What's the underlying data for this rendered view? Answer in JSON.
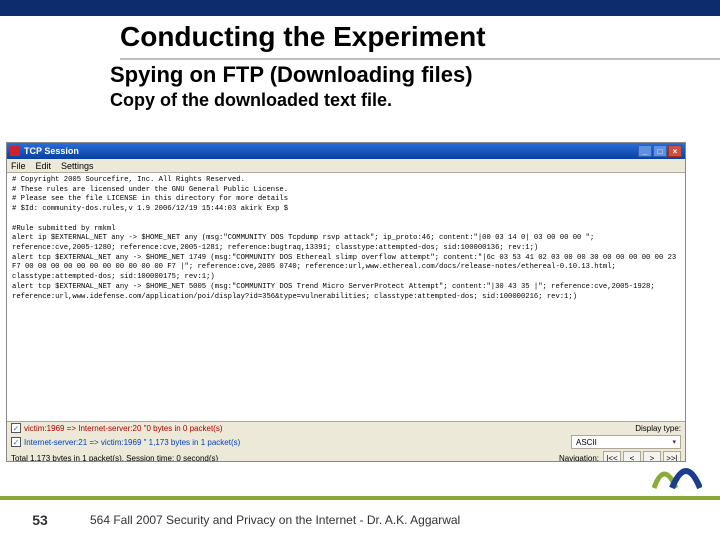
{
  "slide": {
    "title": "Conducting the Experiment",
    "subtitle1": "Spying on FTP (Downloading files)",
    "subtitle2": "Copy of the downloaded text file.",
    "number": "53",
    "footer": "564  Fall 2007 Security and Privacy on the Internet - Dr. A.K. Aggarwal"
  },
  "window": {
    "title": "TCP Session",
    "menu": {
      "file": "File",
      "edit": "Edit",
      "settings": "Settings"
    },
    "winbtns": {
      "min": "_",
      "max": "□",
      "close": "×"
    },
    "text": "# Copyright 2005 Sourcefire, Inc. All Rights Reserved.\n# These rules are licensed under the GNU General Public License.\n# Please see the file LICENSE in this directory for more details\n# $Id: community-dos.rules,v 1.9 2006/12/19 15:44:03 akirk Exp $\n\n#Rule submitted by rmkml\nalert ip $EXTERNAL_NET any -> $HOME_NET any (msg:\"COMMUNITY DOS Tcpdump rsvp attack\"; ip_proto:46; content:\"|00 03 14 0| 03 00 00 00 \"; reference:cve,2005-1280; reference:cve,2005-1281; reference:bugtraq,13391; classtype:attempted-dos; sid:100000136; rev:1;)\nalert tcp $EXTERNAL_NET any -> $HOME_NET 1749 (msg:\"COMMUNITY DOS Ethereal slimp overflow attempt\"; content:\"|6c 03 53 41 02 03 00 00 30 00 00 00 00 00 23 F7 00 00 00 00 00 00 00 00 00 00 00 F7 |\"; reference:cve,2005 0740; reference:url,www.ethereal.com/docs/release-notes/ethereal-0.10.13.html; classtype:attempted-dos; sid:100000175; rev:1;)\nalert tcp $EXTERNAL_NET any -> $HOME_NET 5005 (msg:\"COMMUNITY DOS Trend Micro ServerProtect Attempt\"; content:\"|30 43 35 |\"; reference:cve,2005-1928; reference:url,www.idefense.com/application/poi/display?id=356&type=vulnerabilities; classtype:attempted-dos; sid:100000216; rev:1;)",
    "conn1_label": "victim:1969 => Internet-server:20 \"0 bytes in 0 packet(s)",
    "conn1_checked": "✓",
    "conn2_label": "Internet-server:21 => victim:1969 \" 1,173 bytes in 1 packet(s)",
    "conn2_checked": "✓",
    "total": "Total  1,173 bytes in 1 packet(s). Session time: 0 second(s)",
    "display_label": "Display type:",
    "display_value": "ASCII",
    "navigation_label": "Navigation:",
    "nav": {
      "first": "|<<",
      "prev": "<",
      "next": ">",
      "last": ">>|"
    }
  }
}
